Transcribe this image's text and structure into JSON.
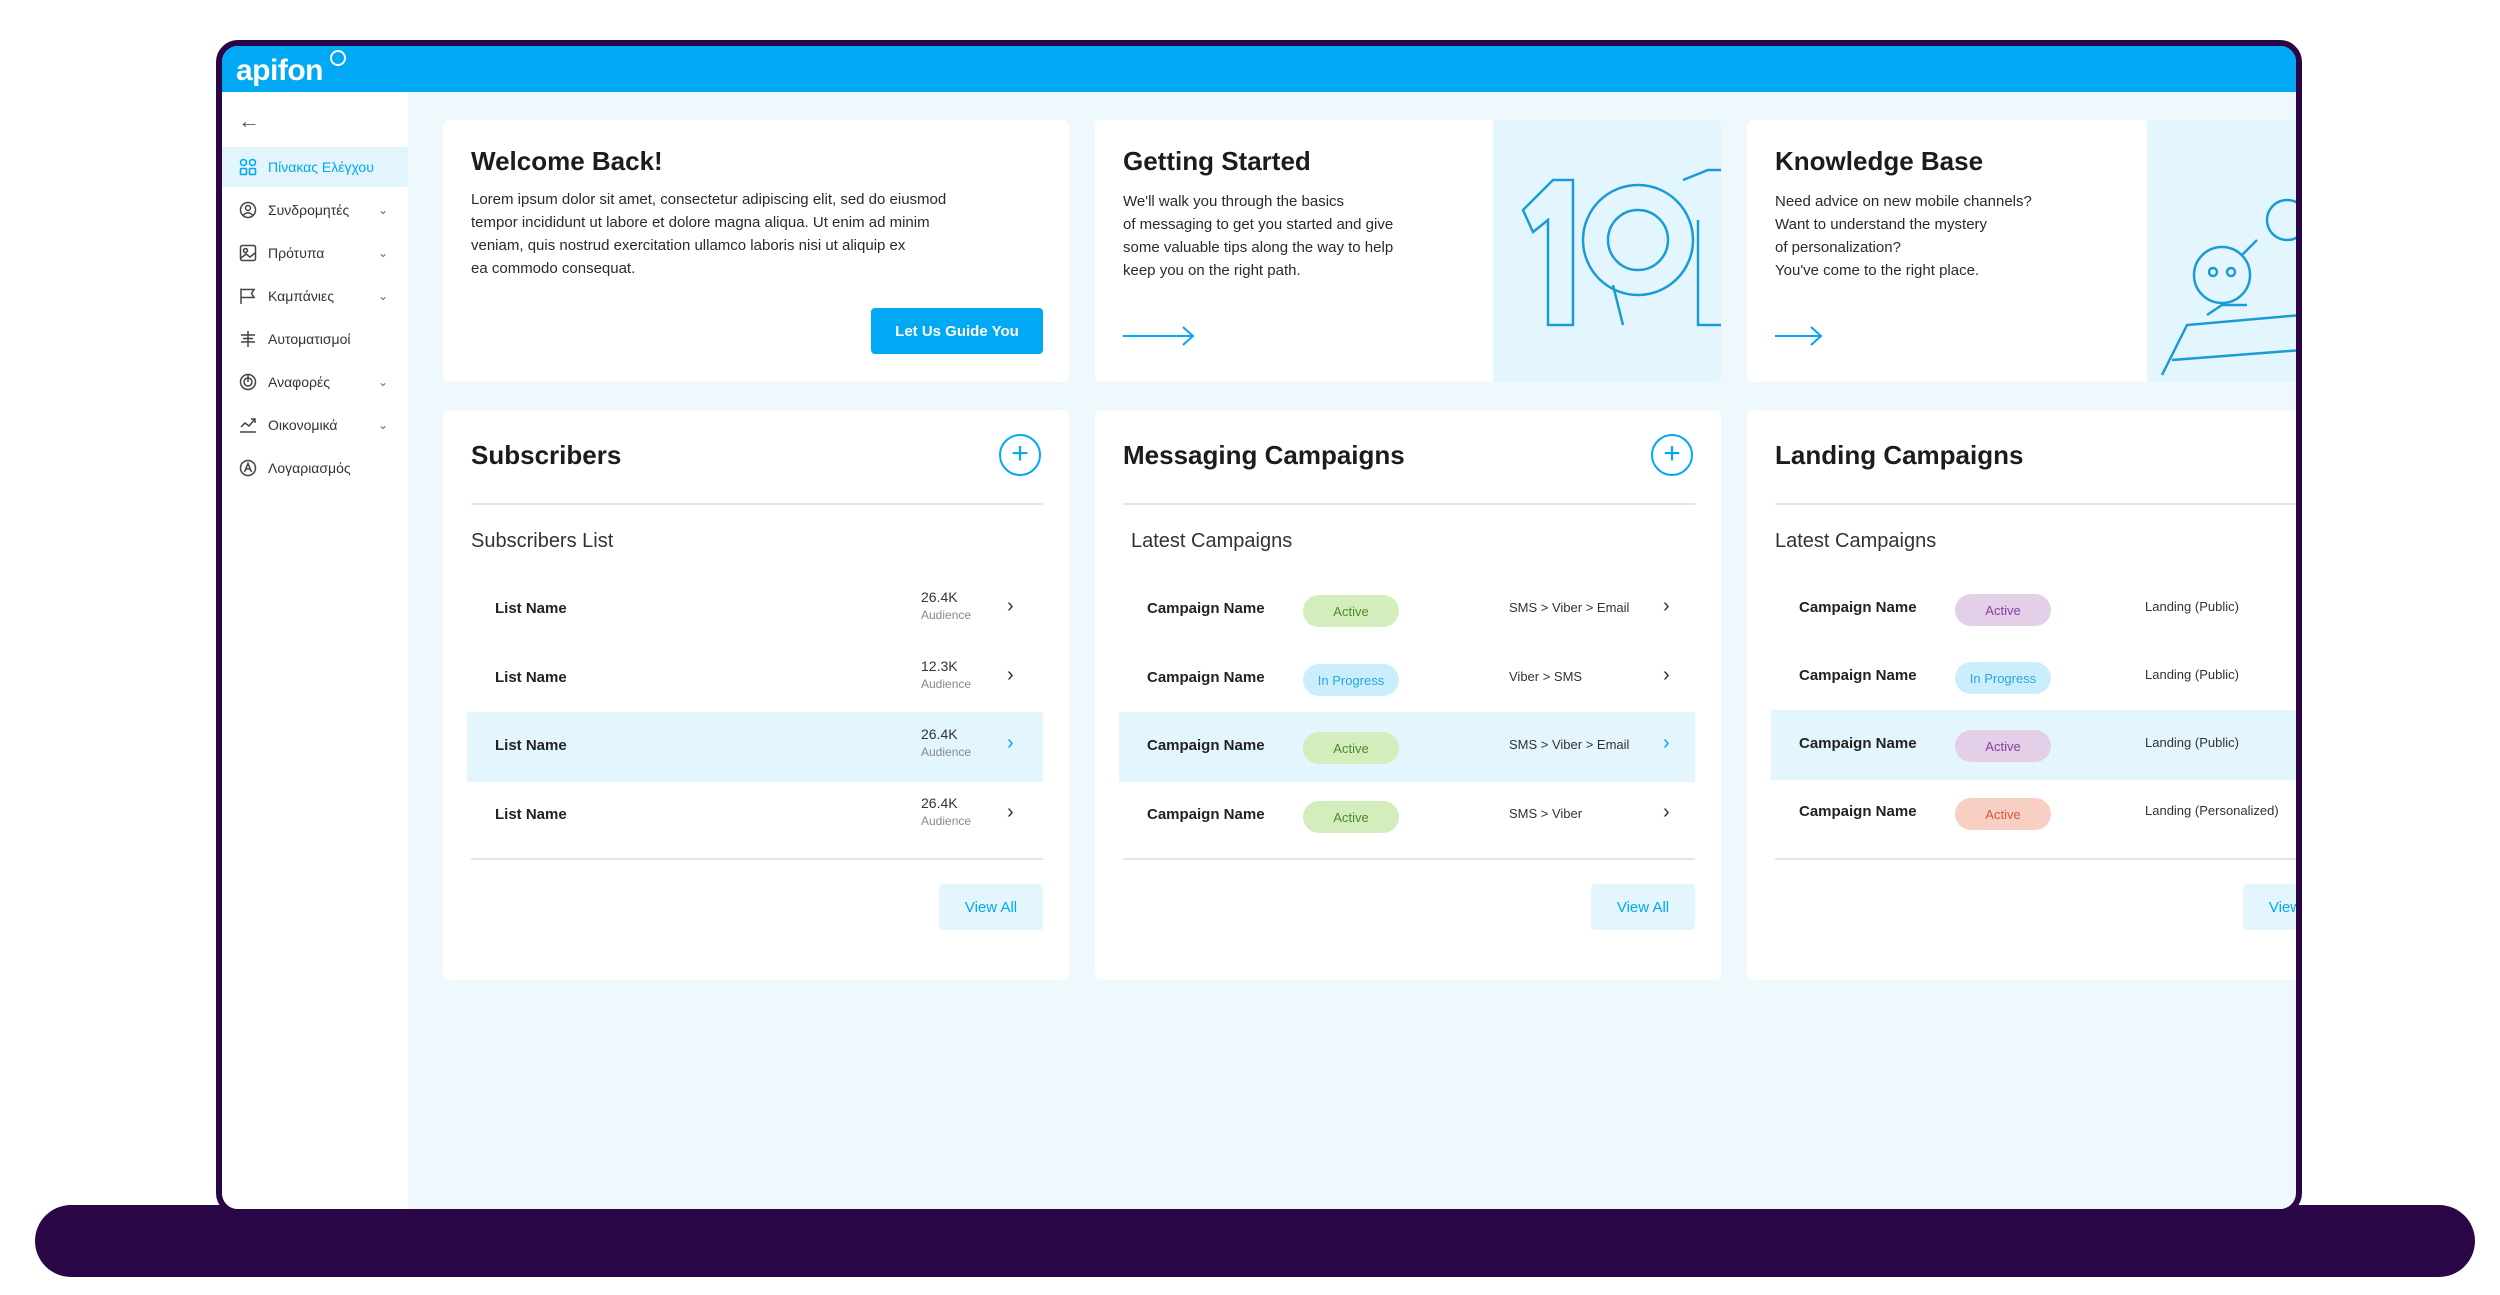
{
  "app": {
    "logo": "apifon"
  },
  "sidebar": {
    "items": [
      {
        "label": "Πίνακας Ελέγχου",
        "icon": "dashboard-icon",
        "active": true
      },
      {
        "label": "Συνδρομητές",
        "icon": "subscribers-icon"
      },
      {
        "label": "Πρότυπα",
        "icon": "templates-icon"
      },
      {
        "label": "Καμπάνιες",
        "icon": "flag-icon"
      },
      {
        "label": "Αυτοματισμοί",
        "icon": "automation-icon"
      },
      {
        "label": "Αναφορές",
        "icon": "reports-icon"
      },
      {
        "label": "Οικονομικά",
        "icon": "finance-icon"
      },
      {
        "label": "Λογαριασμός",
        "icon": "account-icon"
      }
    ]
  },
  "welcome": {
    "title": "Welcome Back!",
    "text_lines": [
      "Lorem ipsum dolor sit amet, consectetur adipiscing elit, sed do eiusmod",
      "tempor incididunt ut labore et dolore magna aliqua. Ut enim ad minim",
      "veniam, quis nostrud exercitation ullamco laboris nisi ut aliquip ex",
      "ea commodo consequat."
    ],
    "button": "Let Us Guide You"
  },
  "getting_started": {
    "title": "Getting Started",
    "text_lines": [
      "We'll walk you through the basics",
      "of messaging to get you started and give",
      "some valuable tips along the way to help",
      "keep you on the right path."
    ]
  },
  "knowledge_base": {
    "title": "Knowledge Base",
    "text_lines": [
      "Need advice on new mobile channels?",
      "Want to understand the mystery",
      "of personalization?",
      "You've come to the right place."
    ]
  },
  "subscribers": {
    "title": "Subscribers",
    "subtitle": "Subscribers List",
    "rows": [
      {
        "name": "List Name",
        "count": "26.4K",
        "aud": "Audience"
      },
      {
        "name": "List Name",
        "count": "12.3K",
        "aud": "Audience"
      },
      {
        "name": "List Name",
        "count": "26.4K",
        "aud": "Audience"
      },
      {
        "name": "List Name",
        "count": "26.4K",
        "aud": "Audience"
      }
    ],
    "view_all": "View All"
  },
  "messaging": {
    "title": "Messaging Campaigns",
    "subtitle": "Latest Campaigns",
    "rows": [
      {
        "name": "Campaign Name",
        "status": "Active",
        "channels": "SMS > Viber > Email"
      },
      {
        "name": "Campaign Name",
        "status": "In Progress",
        "channels": "Viber > SMS"
      },
      {
        "name": "Campaign Name",
        "status": "Active",
        "channels": "SMS > Viber > Email"
      },
      {
        "name": "Campaign Name",
        "status": "Active",
        "channels": "SMS > Viber"
      }
    ],
    "view_all": "View All"
  },
  "landing": {
    "title": "Landing Campaigns",
    "subtitle": "Latest Campaigns",
    "rows": [
      {
        "name": "Campaign Name",
        "status": "Active",
        "type": "Landing (Public)"
      },
      {
        "name": "Campaign Name",
        "status": "In Progress",
        "type": "Landing (Public)"
      },
      {
        "name": "Campaign Name",
        "status": "Active",
        "type": "Landing (Public)"
      },
      {
        "name": "Campaign Name",
        "status": "Active",
        "type": "Landing (Personalized)"
      }
    ],
    "view_all": "View All"
  },
  "colors": {
    "brand": "#01a8f3",
    "frame": "#2a0647",
    "background": "#eef8fd"
  }
}
